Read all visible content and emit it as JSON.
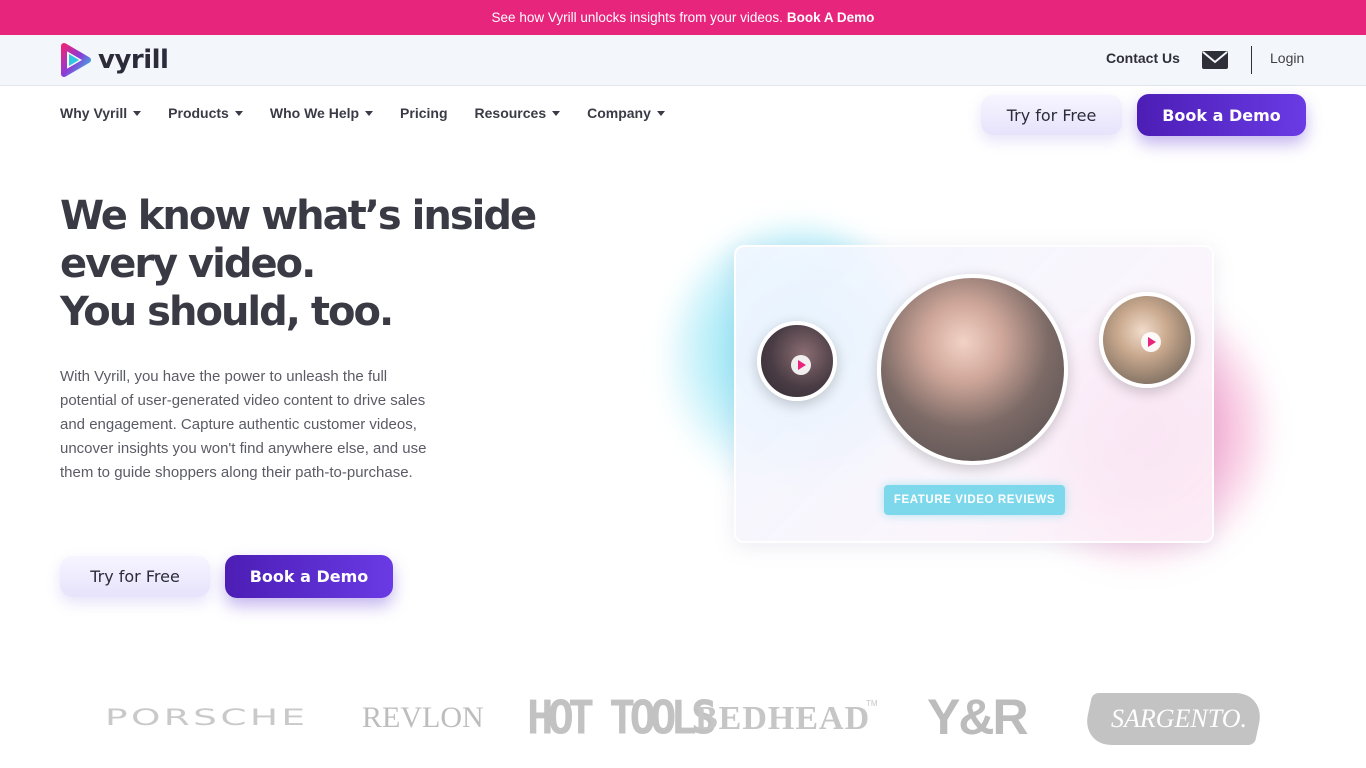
{
  "announcement": {
    "text": "See how Vyrill unlocks insights from your videos.",
    "link": "Book A Demo",
    "background": "#e8257d"
  },
  "utility_bar": {
    "brand": "vyrill",
    "contact": "Contact Us",
    "mail_icon": "envelope-icon",
    "login": "Login"
  },
  "nav": {
    "items": [
      {
        "label": "Why Vyrill",
        "dropdown": true
      },
      {
        "label": "Products",
        "dropdown": true
      },
      {
        "label": "Who We Help",
        "dropdown": true
      },
      {
        "label": "Pricing",
        "dropdown": false
      },
      {
        "label": "Resources",
        "dropdown": true
      },
      {
        "label": "Company",
        "dropdown": true
      }
    ],
    "try_free": "Try for Free",
    "book_demo": "Book a Demo"
  },
  "hero": {
    "title_lines": [
      "We know what’s inside",
      "every video.",
      "You should, too."
    ],
    "description": "With Vyrill, you have the power to unleash the full potential of user-generated video content to drive sales and engagement. Capture authentic customer videos, uncover insights you won't find anywhere else, and use them to guide shoppers along their path-to-purchase.",
    "try_free": "Try for Free",
    "book_demo": "Book a Demo",
    "badge": "FEATURE VIDEO REVIEWS"
  },
  "brands": {
    "porsche": "PORSCHE",
    "revlon": "REVLON",
    "hottools": "HOT TOOLS",
    "bedhead": "BEDHEAD",
    "bedhead_tm": "TM",
    "yr": "Y&R",
    "sargento": "SARGENTO."
  },
  "colors": {
    "accent_pink": "#e8257d",
    "accent_purple": "#5b2ad0",
    "cyan_badge": "#7dd8ec"
  }
}
